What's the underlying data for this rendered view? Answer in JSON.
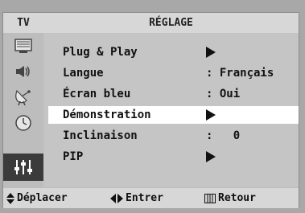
{
  "header": {
    "tv_label": "TV",
    "title": "RÉGLAGE"
  },
  "side_icons": [
    {
      "name": "picture-icon"
    },
    {
      "name": "sound-icon"
    },
    {
      "name": "channel-icon"
    },
    {
      "name": "time-icon"
    },
    {
      "name": "setup-icon"
    }
  ],
  "menu": {
    "items": [
      {
        "label": "Plug & Play",
        "value": "",
        "arrow": true
      },
      {
        "label": "Langue",
        "value": ": Français",
        "arrow": false
      },
      {
        "label": "Écran bleu",
        "value": ": Oui",
        "arrow": false
      },
      {
        "label": "Démonstration",
        "value": "",
        "arrow": true
      },
      {
        "label": "Inclinaison",
        "value": ":   0",
        "arrow": false
      },
      {
        "label": "PIP",
        "value": "",
        "arrow": true
      }
    ]
  },
  "footer": {
    "move": "Déplacer",
    "enter": "Entrer",
    "back": "Retour"
  }
}
